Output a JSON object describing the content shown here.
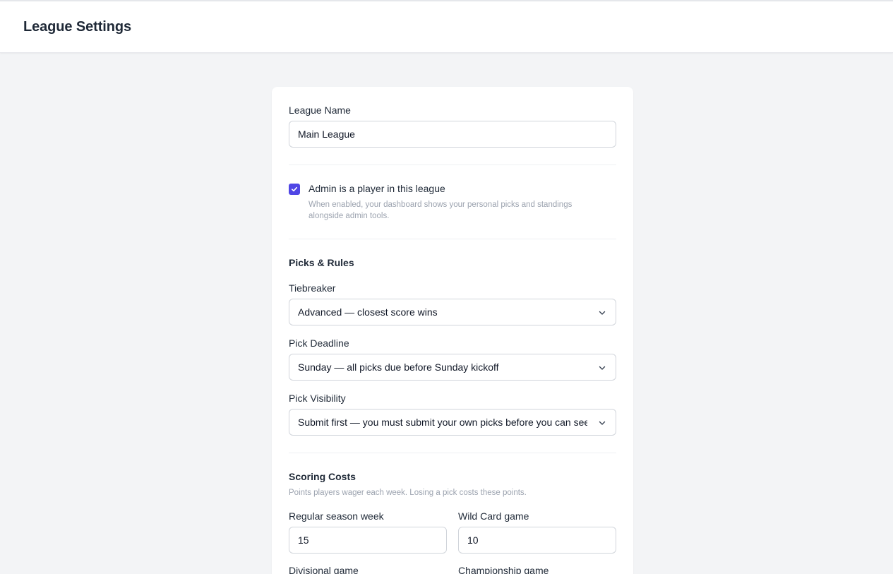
{
  "header": {
    "title": "League Settings"
  },
  "league_name": {
    "label": "League Name",
    "value": "Main League"
  },
  "admin_player": {
    "label": "Admin is a player in this league",
    "checked": true,
    "help": "When enabled, your dashboard shows your personal picks and standings alongside admin tools."
  },
  "picks_rules": {
    "title": "Picks & Rules",
    "tiebreaker": {
      "label": "Tiebreaker",
      "value": "Advanced — closest score wins"
    },
    "pick_deadline": {
      "label": "Pick Deadline",
      "value": "Sunday — all picks due before Sunday kickoff"
    },
    "pick_visibility": {
      "label": "Pick Visibility",
      "value": "Submit first — you must submit your own picks before you can see others' picks"
    }
  },
  "scoring_costs": {
    "title": "Scoring Costs",
    "help": "Points players wager each week. Losing a pick costs these points.",
    "regular_season": {
      "label": "Regular season week",
      "value": "15"
    },
    "wild_card": {
      "label": "Wild Card game",
      "value": "10"
    },
    "divisional": {
      "label": "Divisional game"
    },
    "championship": {
      "label": "Championship game"
    }
  },
  "colors": {
    "accent": "#4f46e5",
    "background": "#f3f4f6",
    "border": "#d1d5db"
  },
  "icons": {
    "checkbox": "check-icon",
    "select": "chevron-down-icon"
  }
}
